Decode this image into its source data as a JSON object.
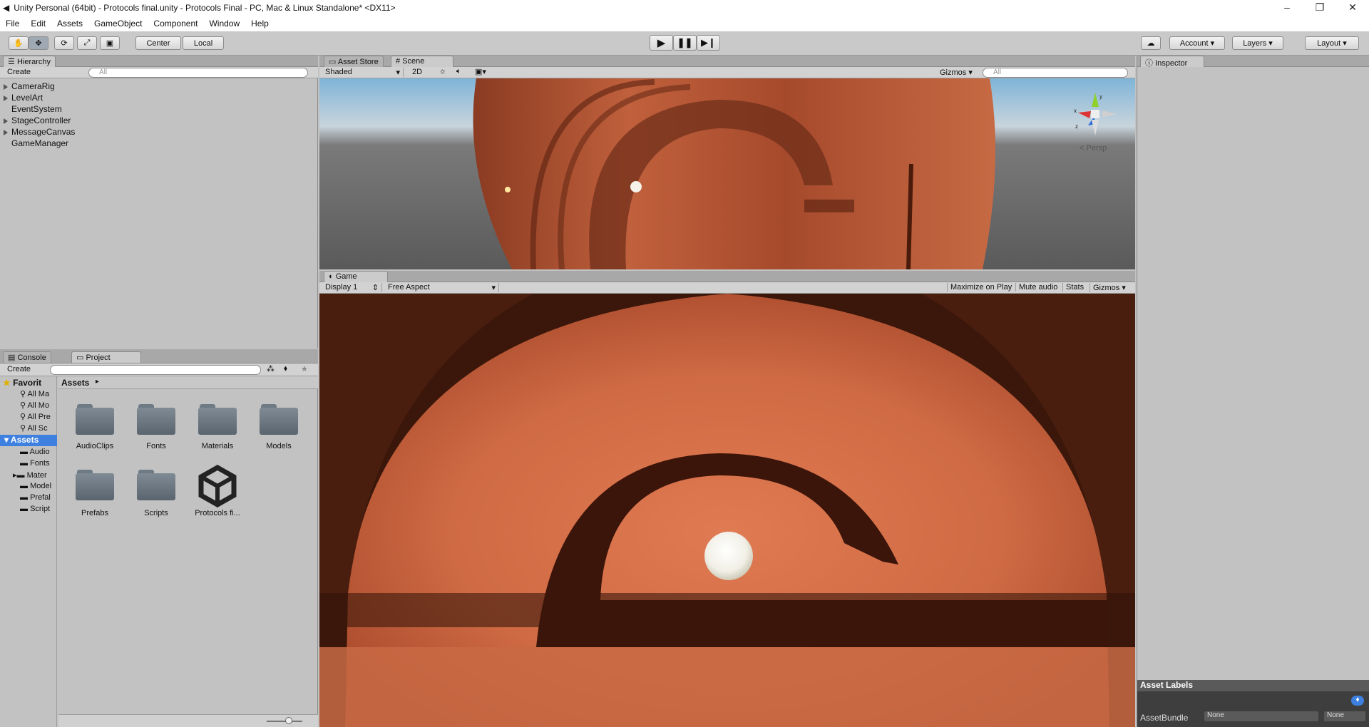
{
  "window": {
    "title": "Unity Personal (64bit) - Protocols final.unity - Protocols Final - PC, Mac & Linux Standalone* <DX11>"
  },
  "menu": [
    "File",
    "Edit",
    "Assets",
    "GameObject",
    "Component",
    "Window",
    "Help"
  ],
  "toolbar": {
    "pivot": "Center",
    "space": "Local",
    "account": "Account",
    "layers": "Layers",
    "layout": "Layout"
  },
  "hierarchy": {
    "tab": "Hierarchy",
    "create": "Create",
    "search_placeholder": "All",
    "items": [
      {
        "label": "CameraRig",
        "expandable": true
      },
      {
        "label": "LevelArt",
        "expandable": true
      },
      {
        "label": "EventSystem",
        "expandable": false
      },
      {
        "label": "StageController",
        "expandable": true
      },
      {
        "label": "MessageCanvas",
        "expandable": true
      },
      {
        "label": "GameManager",
        "expandable": false
      }
    ]
  },
  "scene": {
    "tabs": [
      "Asset Store",
      "Scene"
    ],
    "shading": "Shaded",
    "mode2d": "2D",
    "gizmos": "Gizmos",
    "search_placeholder": "All",
    "persp": "Persp"
  },
  "game": {
    "tab": "Game",
    "display": "Display 1",
    "aspect": "Free Aspect",
    "buttons": [
      "Maximize on Play",
      "Mute audio",
      "Stats",
      "Gizmos"
    ]
  },
  "project": {
    "tabs": [
      "Console",
      "Project"
    ],
    "create": "Create",
    "favorites": {
      "title": "Favorit",
      "items": [
        "All Ma",
        "All Mo",
        "All Pre",
        "All Sc"
      ]
    },
    "assets_tree": {
      "title": "Assets",
      "items": [
        "Audio",
        "Fonts",
        "Mater",
        "Model",
        "Prefal",
        "Script"
      ]
    },
    "breadcrumb": "Assets",
    "grid": [
      "AudioClips",
      "Fonts",
      "Materials",
      "Models",
      "Prefabs",
      "Scripts",
      "Protocols fi..."
    ]
  },
  "inspector": {
    "tab": "Inspector",
    "asset_labels": "Asset Labels",
    "asset_bundle": "AssetBundle",
    "bundle_value": "None",
    "bundle_variant": "None"
  },
  "colors": {
    "accent_green": "#7cc400",
    "wood": "#c4603a",
    "panel_bg": "#c2c2c2"
  }
}
